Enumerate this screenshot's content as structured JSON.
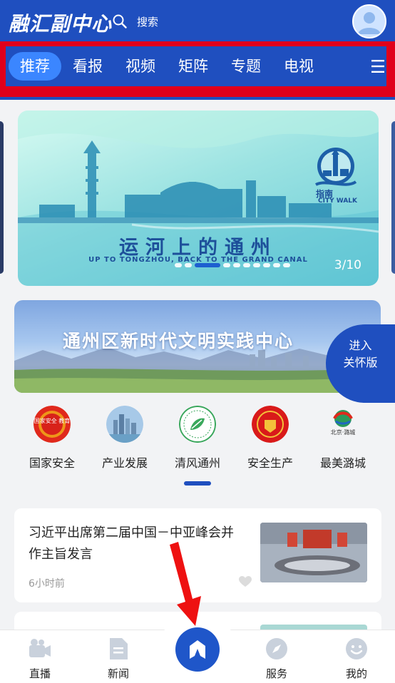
{
  "header": {
    "logo": "融汇副中心",
    "search_label": "搜索",
    "icons": {
      "search": "search-icon",
      "avatar": "user-avatar"
    }
  },
  "tabs": [
    "推荐",
    "看报",
    "视频",
    "矩阵",
    "专题",
    "电视"
  ],
  "active_tab": "推荐",
  "banner": {
    "title": "运河上的通州",
    "subtitle": "UP TO TONGZHOU, BACK TO THE GRAND CANAL",
    "citywalk_cn": "指南",
    "citywalk_en": "CITY WALK",
    "counter": "3/10",
    "current_index": 3,
    "total": 10
  },
  "civilization_banner": {
    "title": "通州区新时代文明实践中心"
  },
  "care_button": {
    "line1": "进入",
    "line2": "关怀版"
  },
  "quick_links": [
    {
      "label": "国家安全",
      "badge_text": "国家安全 教育",
      "icon": "national-security-icon"
    },
    {
      "label": "产业发展",
      "icon": "industry-icon"
    },
    {
      "label": "清风通州",
      "icon": "clean-wind-icon"
    },
    {
      "label": "安全生产",
      "icon": "safety-production-icon"
    },
    {
      "label": "最美潞城",
      "badge_text": "北京·潞城",
      "icon": "lucheng-icon"
    }
  ],
  "news": [
    {
      "title": "习近平出席第二届中国－中亚峰会并作主旨发言",
      "time": "6小时前"
    }
  ],
  "bottom_nav": [
    {
      "label": "直播",
      "icon": "live-camera-icon"
    },
    {
      "label": "新闻",
      "icon": "news-document-icon"
    },
    {
      "label": "",
      "icon": "home-icon"
    },
    {
      "label": "服务",
      "icon": "compass-icon"
    },
    {
      "label": "我的",
      "icon": "smile-icon"
    }
  ],
  "colors": {
    "brand_blue": "#1f4fbf",
    "active_tab": "#3b86ff",
    "highlight_red": "#e0001b",
    "annotation_arrow": "#ee1111"
  }
}
